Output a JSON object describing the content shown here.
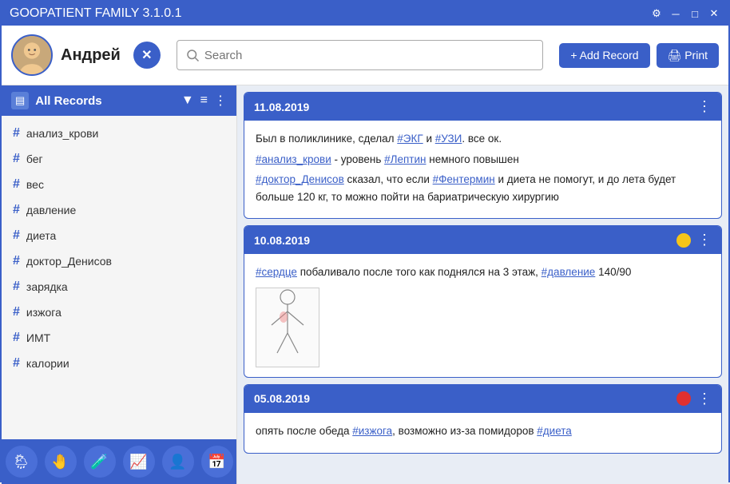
{
  "titleBar": {
    "title": "GOOPATIENT FAMILY 3.1.0.1",
    "settingsIcon": "⚙",
    "minimizeIcon": "─",
    "maximizeIcon": "□",
    "closeIcon": "✕"
  },
  "header": {
    "userName": "Андрей",
    "closeUserLabel": "✕",
    "search": {
      "placeholder": "Search"
    },
    "addRecordLabel": "+ Add Record",
    "printLabel": "🖨 Print"
  },
  "sidebar": {
    "allRecordsLabel": "All Records",
    "tags": [
      "анализ_крови",
      "бег",
      "вес",
      "давление",
      "диета",
      "доктор_Денисов",
      "зарядка",
      "изжога",
      "ИМТ",
      "калории"
    ],
    "navIcons": [
      "🌦",
      "🤚",
      "🧪",
      "📈",
      "👤",
      "📅"
    ]
  },
  "records": [
    {
      "date": "11.08.2019",
      "dot": null,
      "lines": [
        "Был в поликлинике, сделал #ЭКГ и #УЗИ. все ок.",
        "#анализ_крови - уровень #Лептин немного повышен",
        "#доктор_Денисов сказал, что если #Фентермин и диета не помогут, и до лета будет больше 120 кг, то можно пойти на бариатрическую хирургию"
      ],
      "links": [
        "#ЭКГ",
        "#УЗИ",
        "#анализ_крови",
        "#Лептин",
        "#доктор_Денисов",
        "#Фентермин"
      ]
    },
    {
      "date": "10.08.2019",
      "dot": "#f5c518",
      "lines": [
        "#сердце побаливало после того как поднялся на 3 этаж, #давление 140/90"
      ],
      "links": [
        "#сердце",
        "#давление"
      ],
      "hasImage": true
    },
    {
      "date": "05.08.2019",
      "dot": "#e03030",
      "lines": [
        "опять после обеда #изжога, возможно из-за помидоров #диета"
      ],
      "links": [
        "#изжога",
        "#диета"
      ]
    }
  ]
}
